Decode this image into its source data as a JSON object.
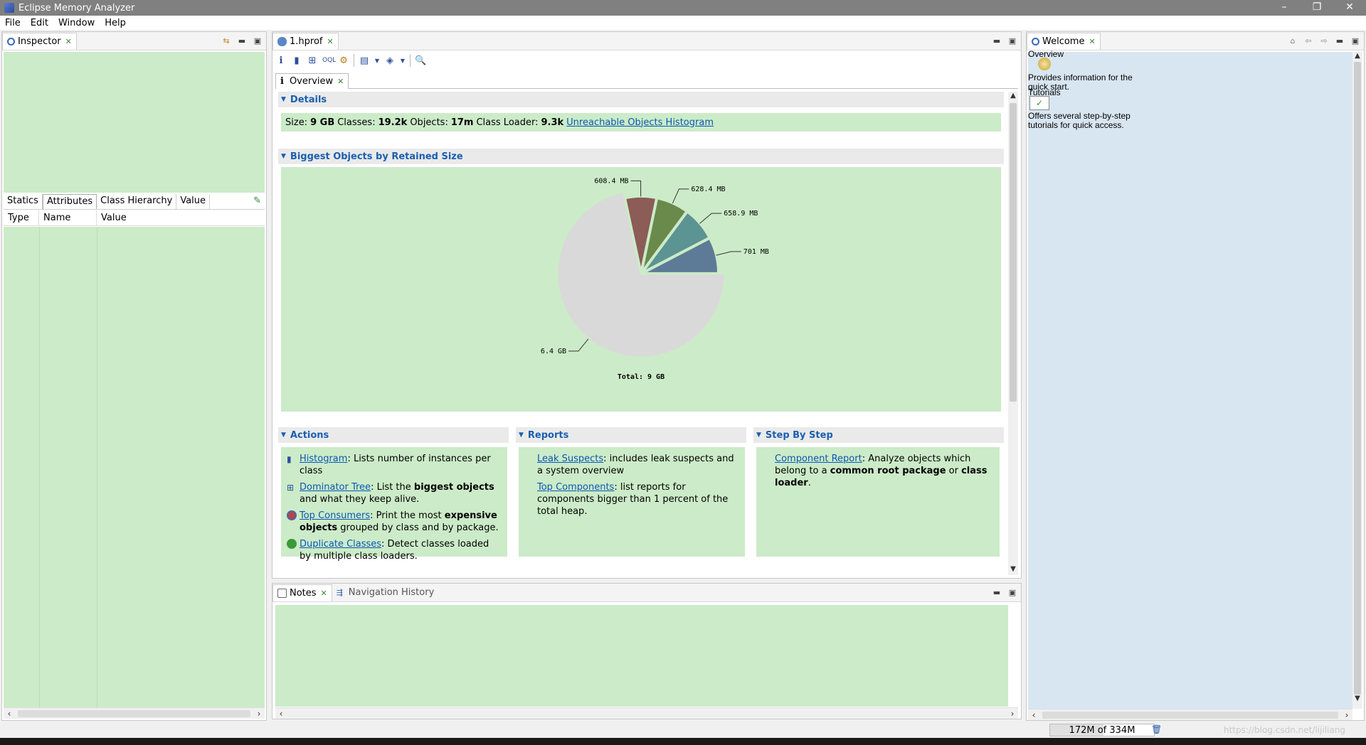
{
  "window": {
    "title": "Eclipse Memory Analyzer"
  },
  "menu": [
    "File",
    "Edit",
    "Window",
    "Help"
  ],
  "inspector": {
    "tab_label": "Inspector",
    "subtabs": [
      "Statics",
      "Attributes",
      "Class Hierarchy",
      "Value"
    ],
    "columns": [
      "Type",
      "Name",
      "Value"
    ]
  },
  "editor": {
    "tab_label": "1.hprof",
    "subtab_label": "Overview",
    "details": {
      "header": "Details",
      "size_label": "Size:",
      "size_value": "9 GB",
      "classes_label": "Classes:",
      "classes_value": "19.2k",
      "objects_label": "Objects:",
      "objects_value": "17m",
      "loader_label": "Class Loader:",
      "loader_value": "9.3k",
      "link": "Unreachable Objects Histogram"
    },
    "biggest_header": "Biggest Objects by Retained Size",
    "actions": {
      "header": "Actions",
      "items": [
        {
          "link": "Histogram",
          "text": ": Lists number of instances per class"
        },
        {
          "link": "Dominator Tree",
          "text": ": List the ",
          "bold": "biggest objects",
          "text2": " and what they keep alive."
        },
        {
          "link": "Top Consumers",
          "text": ": Print the most ",
          "bold": "expensive objects",
          "text2": " grouped by class and by package."
        },
        {
          "link": "Duplicate Classes",
          "text": ": Detect classes loaded by multiple class loaders."
        }
      ]
    },
    "reports": {
      "header": "Reports",
      "items": [
        {
          "link": "Leak Suspects",
          "text": ": includes leak suspects and a system overview"
        },
        {
          "link": "Top Components",
          "text": ": list reports for components bigger than 1 percent of the total heap."
        }
      ]
    },
    "stepbystep": {
      "header": "Step By Step",
      "link": "Component Report",
      "text": ": Analyze objects which belong to a ",
      "bold1": "common root package",
      "mid": " or ",
      "bold2": "class loader",
      "end": "."
    }
  },
  "notes": {
    "tab_label": "Notes",
    "nav_label": "Navigation History"
  },
  "welcome": {
    "tab_label": "Welcome",
    "overview_title": "Overview",
    "overview_desc": "Provides information for the quick start.",
    "tutorials_title": "Tutorials",
    "tutorials_desc": "Offers several step-by-step tutorials for quick access."
  },
  "status": {
    "heap": "172M of 334M",
    "heap_used_fraction": 0.515,
    "watermark": "https://blog.csdn.net/lijiliang"
  },
  "chart_data": {
    "type": "pie",
    "title": "",
    "total_label": "Total:  9 GB",
    "slices": [
      {
        "label": "701 MB",
        "value": 701,
        "color": "#5d7b96"
      },
      {
        "label": "658.9 MB",
        "value": 658.9,
        "color": "#5c9393"
      },
      {
        "label": "628.4 MB",
        "value": 628.4,
        "color": "#6a8a4c"
      },
      {
        "label": "608.4 MB",
        "value": 608.4,
        "color": "#8c5c57"
      },
      {
        "label": "6.4 GB",
        "value": 6553.6,
        "color": "#d9d9d9"
      }
    ]
  }
}
